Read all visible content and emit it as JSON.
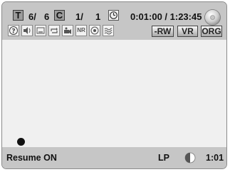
{
  "status_bar": {
    "title_letter": "T",
    "title_current": "6/",
    "title_total": "6",
    "chapter_letter": "C",
    "chapter_current": "1/",
    "chapter_total": "1",
    "time": "0:01:00 / 1:23:45"
  },
  "function_icons": [
    {
      "name": "help-icon"
    },
    {
      "name": "audio-icon"
    },
    {
      "name": "subtitle-icon"
    },
    {
      "name": "repeat-icon"
    },
    {
      "name": "angle-icon"
    },
    {
      "name": "noise-reduction-icon",
      "text": "NR"
    },
    {
      "name": "zoom-icon"
    },
    {
      "name": "picture-adjust-icon"
    }
  ],
  "disc_badges": [
    "-RW",
    "VR",
    "ORG"
  ],
  "bottom_bar": {
    "resume": "Resume ON",
    "mode": "LP",
    "remaining": "1:01"
  }
}
